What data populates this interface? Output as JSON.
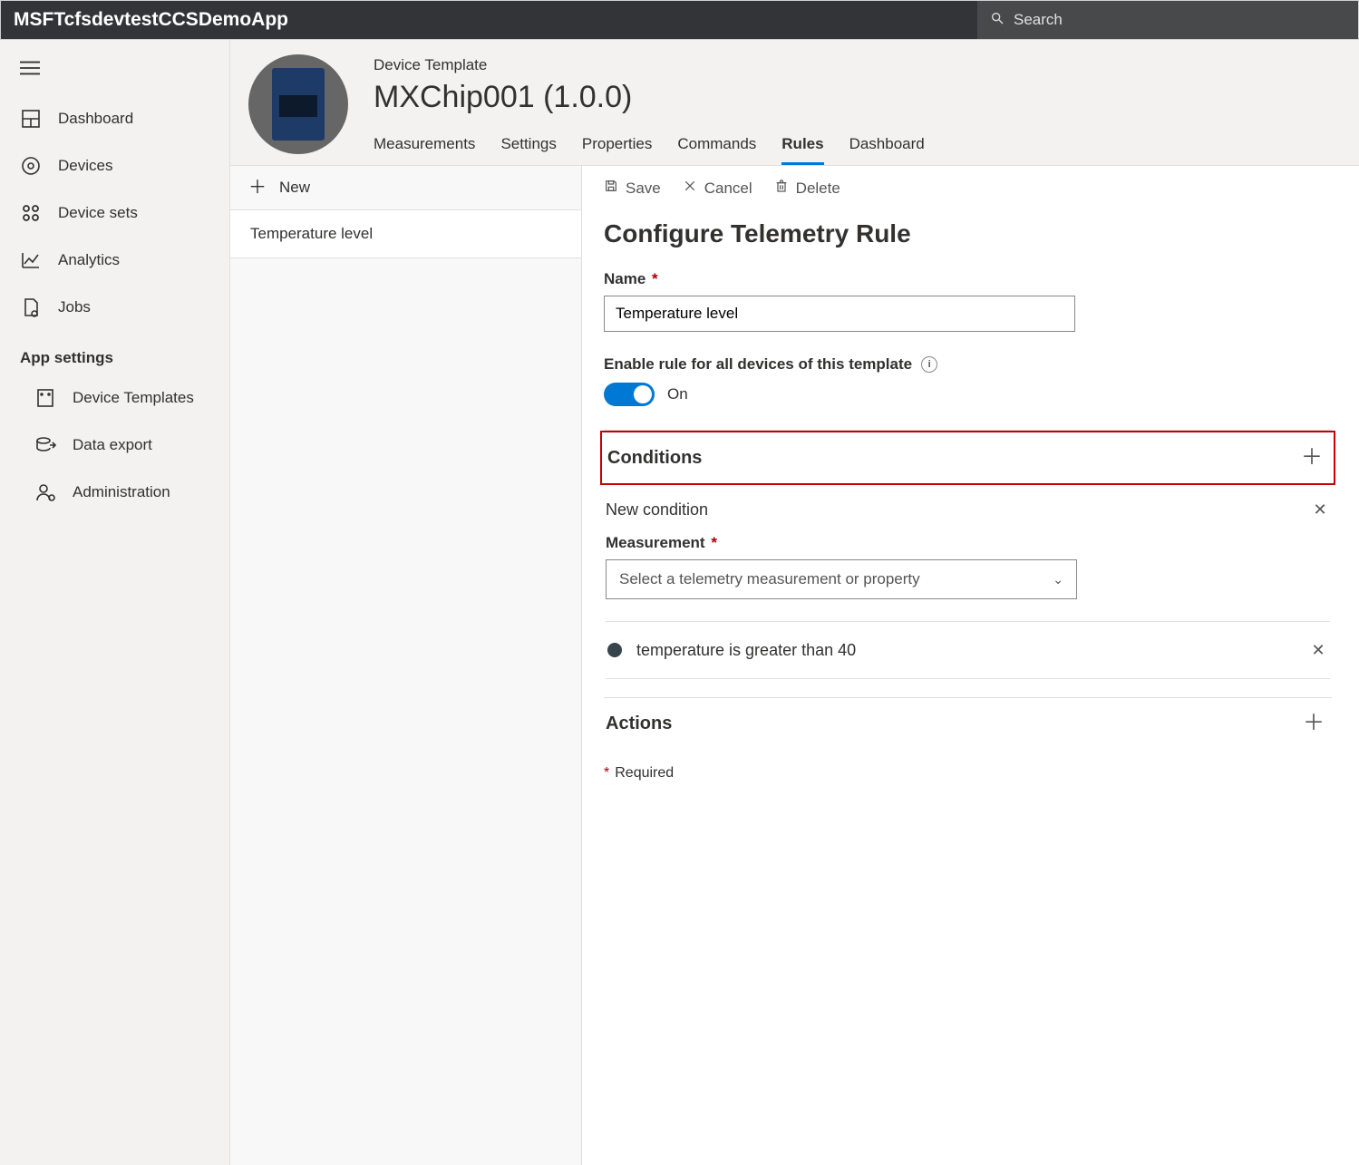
{
  "app_title": "MSFTcfsdevtestCCSDemoApp",
  "search_placeholder": "Search",
  "sidebar": {
    "items": [
      {
        "icon": "dashboard",
        "label": "Dashboard"
      },
      {
        "icon": "devices",
        "label": "Devices"
      },
      {
        "icon": "sets",
        "label": "Device sets"
      },
      {
        "icon": "analytics",
        "label": "Analytics"
      },
      {
        "icon": "jobs",
        "label": "Jobs"
      }
    ],
    "section_label": "App settings",
    "settings": [
      {
        "icon": "templates",
        "label": "Device Templates"
      },
      {
        "icon": "export",
        "label": "Data export"
      },
      {
        "icon": "admin",
        "label": "Administration"
      }
    ]
  },
  "template": {
    "breadcrumb": "Device Template",
    "title": "MXChip001  (1.0.0)",
    "tabs": [
      "Measurements",
      "Settings",
      "Properties",
      "Commands",
      "Rules",
      "Dashboard"
    ],
    "active_tab": "Rules"
  },
  "rules_list": {
    "new_label": "New",
    "rows": [
      "Temperature level"
    ]
  },
  "panel": {
    "toolbar": {
      "save": "Save",
      "cancel": "Cancel",
      "delete": "Delete"
    },
    "heading": "Configure Telemetry Rule",
    "name_label": "Name",
    "name_value": "Temperature level",
    "enable_label": "Enable rule for all devices of this template",
    "enable_state": "On",
    "conditions_label": "Conditions",
    "new_condition_label": "New condition",
    "measurement_label": "Measurement",
    "measurement_placeholder": "Select a telemetry measurement or property",
    "condition_summary": "temperature is greater than 40",
    "actions_label": "Actions",
    "required_label": "Required"
  }
}
